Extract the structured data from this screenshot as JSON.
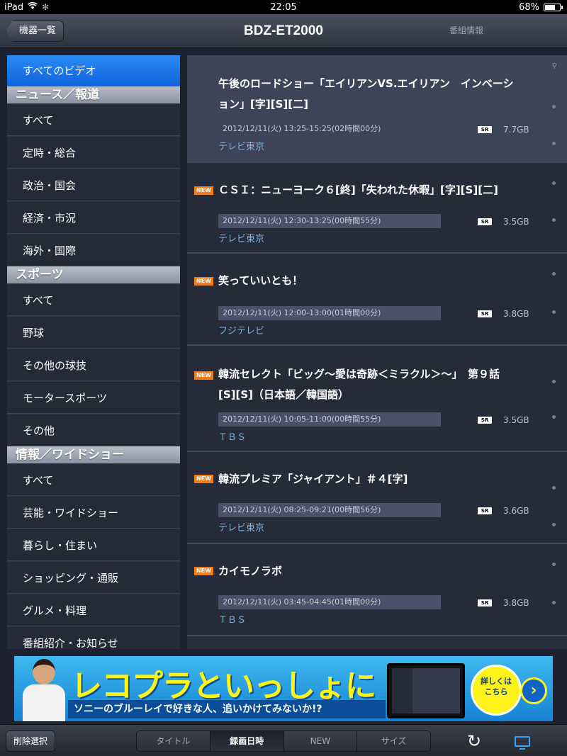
{
  "status_bar": {
    "device": "iPad",
    "time": "22:05",
    "battery": "68%"
  },
  "nav_bar": {
    "back_label": "機器一覧",
    "title": "BDZ-ET2000",
    "right_label": "番組情報"
  },
  "sidebar": {
    "top_item": "すべてのビデオ",
    "sections": [
      {
        "header": "ニュース／報道",
        "items": [
          "すべて",
          "定時・総合",
          "政治・国会",
          "経済・市況",
          "海外・国際"
        ]
      },
      {
        "header": "スポーツ",
        "items": [
          "すべて",
          "野球",
          "その他の球技",
          "モータースポーツ",
          "その他"
        ]
      },
      {
        "header": "情報／ワイドショー",
        "items": [
          "すべて",
          "芸能・ワイドショー",
          "暮らし・住まい",
          "ショッピング・通販",
          "グルメ・料理",
          "番組紹介・お知らせ"
        ]
      }
    ]
  },
  "recordings": [
    {
      "new": "",
      "title_line1": "午後のロードショー「エイリアンVS.エイリアン　インベーシ",
      "title_line2": "ョン」[字][S][二]",
      "datetime": "2012/12/11(火) 13:25-15:25(02時間00分)",
      "quality": "SR",
      "size": "7.7GB",
      "channel": "テレビ東京"
    },
    {
      "new": "NEW",
      "title_line1": "ＣＳＩ：ニューヨーク６[終]「失われた休暇」[字][S][二]",
      "title_line2": "",
      "datetime": "2012/12/11(火) 12:30-13:25(00時間55分)",
      "quality": "SR",
      "size": "3.5GB",
      "channel": "テレビ東京"
    },
    {
      "new": "NEW",
      "title_line1": "笑っていいとも！",
      "title_line2": "",
      "datetime": "2012/12/11(火) 12:00-13:00(01時間00分)",
      "quality": "SR",
      "size": "3.8GB",
      "channel": "フジテレビ"
    },
    {
      "new": "NEW",
      "title_line1": "韓流セレクト「ビッグ〜愛は奇跡＜ミラクル＞〜」　第９話",
      "title_line2": "[S][S]（日本語／韓国語）",
      "datetime": "2012/12/11(火) 10:05-11:00(00時間55分)",
      "quality": "SR",
      "size": "3.5GB",
      "channel": "ＴＢＳ"
    },
    {
      "new": "NEW",
      "title_line1": "韓流プレミア「ジャイアント」＃４[字]",
      "title_line2": "",
      "datetime": "2012/12/11(火) 08:25-09:21(00時間56分)",
      "quality": "SR",
      "size": "3.6GB",
      "channel": "テレビ東京"
    },
    {
      "new": "NEW",
      "title_line1": "カイモノラボ",
      "title_line2": "",
      "datetime": "2012/12/11(火) 03:45-04:45(01時間00分)",
      "quality": "SR",
      "size": "3.8GB",
      "channel": "ＴＢＳ"
    }
  ],
  "banner": {
    "headline": "レコプラといっしょに",
    "subline": "ソニーのブルーレイで好きな人、追いかけてみないか!?",
    "cta": "詳しくは\nこちら"
  },
  "bottom_bar": {
    "delete_label": "削除選択",
    "sort_tabs": [
      "タイトル",
      "録画日時",
      "NEW",
      "サイズ"
    ],
    "active_tab": "録画日時"
  },
  "colors": {
    "accent_blue": "#1a73e8",
    "new_badge": "#f07d18",
    "channel_text": "#7fb2d9",
    "banner_yellow": "#fff31a"
  }
}
